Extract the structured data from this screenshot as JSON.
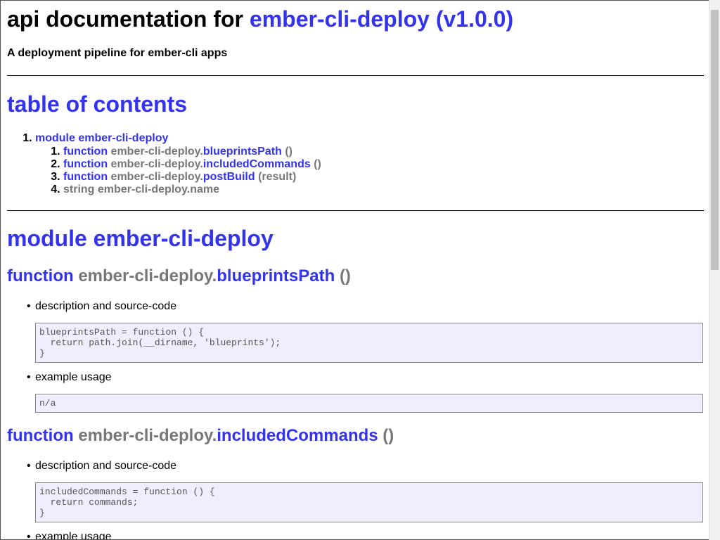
{
  "header": {
    "title_prefix": "api documentation for",
    "title_link": "ember-cli-deploy (v1.0.0)",
    "subtitle": "A deployment pipeline for ember-cli apps"
  },
  "toc": {
    "heading": "table of contents",
    "module_label": "module ember-cli-deploy",
    "items": [
      {
        "kind": "function",
        "prefix": "ember-cli-deploy.",
        "name": "blueprintsPath",
        "args": "()"
      },
      {
        "kind": "function",
        "prefix": "ember-cli-deploy.",
        "name": "includedCommands",
        "args": "()"
      },
      {
        "kind": "function",
        "prefix": "ember-cli-deploy.",
        "name": "postBuild",
        "args": "(result)"
      },
      {
        "kind": "string",
        "prefix": "ember-cli-deploy.",
        "name": "name",
        "args": ""
      }
    ]
  },
  "module_section": {
    "heading": "module ember-cli-deploy",
    "functions": [
      {
        "kind": "function",
        "prefix": "ember-cli-deploy.",
        "name": "blueprintsPath",
        "args": "()",
        "desc_label": "description and source-code",
        "code": "blueprintsPath = function () {\n  return path.join(__dirname, 'blueprints');\n}",
        "example_label": "example usage",
        "example": "n/a"
      },
      {
        "kind": "function",
        "prefix": "ember-cli-deploy.",
        "name": "includedCommands",
        "args": "()",
        "desc_label": "description and source-code",
        "code": "includedCommands = function () {\n  return commands;\n}",
        "example_label": "example usage"
      }
    ]
  }
}
